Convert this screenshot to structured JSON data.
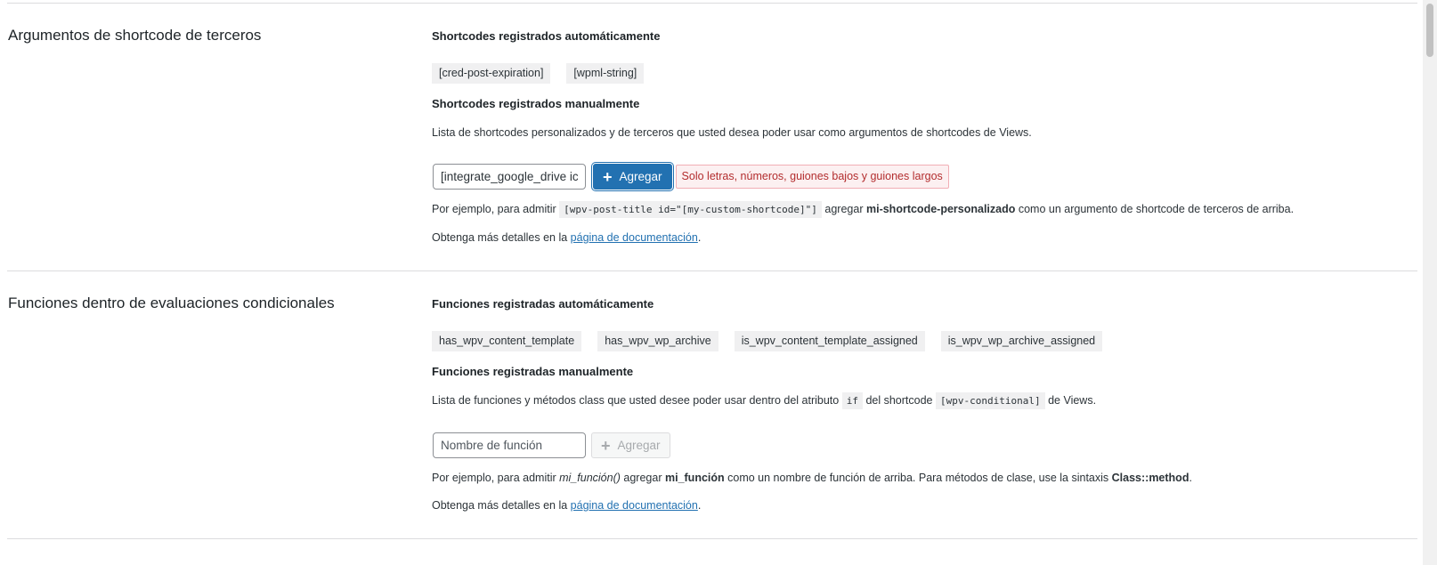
{
  "section1": {
    "title": "Argumentos de shortcode de terceros",
    "auto_heading": "Shortcodes registrados automáticamente",
    "auto_items": [
      "[cred-post-expiration]",
      "[wpml-string]"
    ],
    "manual_heading": "Shortcodes registrados manualmente",
    "manual_desc": "Lista de shortcodes personalizados y de terceros que usted desea poder usar como argumentos de shortcodes de Views.",
    "input_value": "[integrate_google_drive ic",
    "add_button": "Agregar",
    "error": "Solo letras, números, guiones bajos y guiones largos",
    "example_prefix": "Por ejemplo, para admitir",
    "example_code": "[wpv-post-title id=\"[my-custom-shortcode]\"]",
    "example_mid": "agregar",
    "example_bold": "mi-shortcode-personalizado",
    "example_suffix": "como un argumento de shortcode de terceros de arriba.",
    "docs_prefix": "Obtenga más detalles en la",
    "docs_link": "página de documentación",
    "docs_suffix": "."
  },
  "section2": {
    "title": "Funciones dentro de evaluaciones condicionales",
    "auto_heading": "Funciones registradas automáticamente",
    "auto_items": [
      "has_wpv_content_template",
      "has_wpv_wp_archive",
      "is_wpv_content_template_assigned",
      "is_wpv_wp_archive_assigned"
    ],
    "manual_heading": "Funciones registradas manualmente",
    "desc_prefix": "Lista de funciones y métodos class que usted desee poder usar dentro del atributo",
    "desc_code1": "if",
    "desc_mid": "del shortcode",
    "desc_code2": "[wpv-conditional]",
    "desc_suffix": "de Views.",
    "input_placeholder": "Nombre de función",
    "add_button": "Agregar",
    "example_prefix": "Por ejemplo, para admitir",
    "example_italic": "mi_función()",
    "example_mid": "agregar",
    "example_bold": "mi_función",
    "example_mid2": "como un nombre de función de arriba. Para métodos de clase, use la sintaxis",
    "example_bold2": "Class::method",
    "example_suffix": ".",
    "docs_prefix": "Obtenga más detalles en la",
    "docs_link": "página de documentación",
    "docs_suffix": "."
  }
}
